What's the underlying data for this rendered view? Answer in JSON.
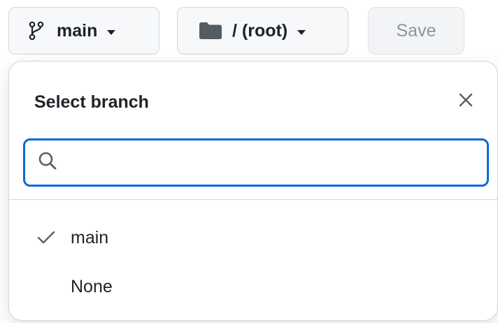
{
  "toolbar": {
    "branch_button": {
      "icon": "git-branch-icon",
      "label": "main"
    },
    "folder_button": {
      "icon": "folder-icon",
      "label": "/ (root)"
    },
    "save_button": {
      "label": "Save"
    }
  },
  "branch_menu": {
    "title": "Select branch",
    "close_icon": "close-icon",
    "search": {
      "icon": "search-icon",
      "value": "",
      "placeholder": ""
    },
    "options": [
      {
        "label": "main",
        "selected": true
      },
      {
        "label": "None",
        "selected": false
      }
    ]
  },
  "colors": {
    "focus_accent": "#0969da",
    "button_bg": "#f6f8fa",
    "border": "#d0d7de",
    "text": "#1f2328",
    "disabled_text": "#8c959f"
  }
}
